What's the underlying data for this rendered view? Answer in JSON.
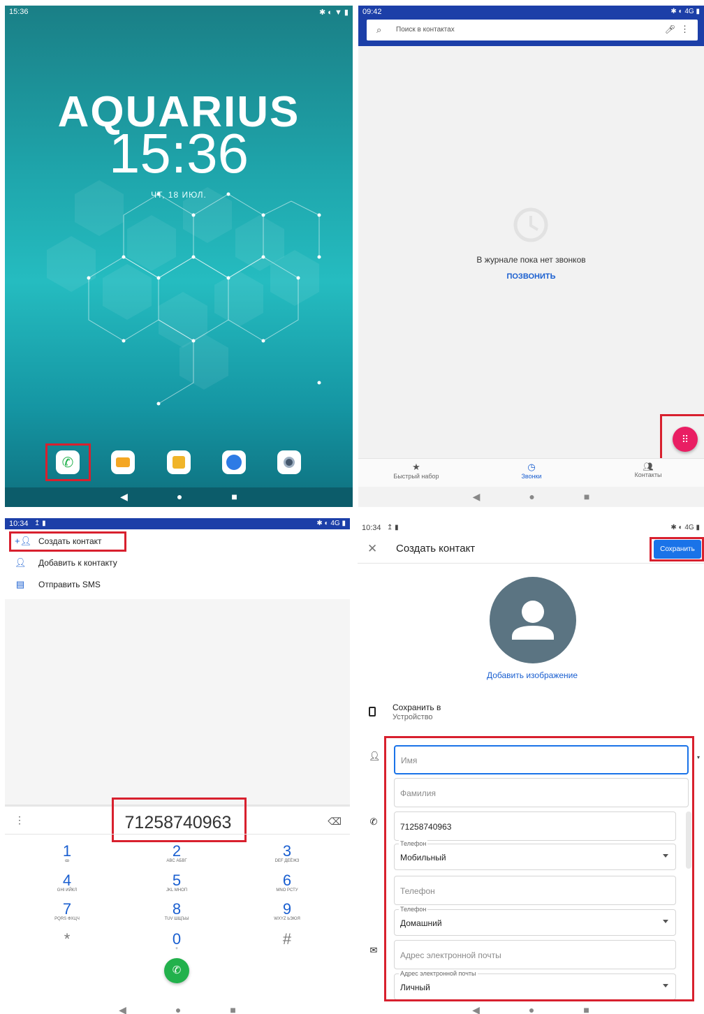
{
  "home": {
    "time_status": "15:36",
    "brand": "AQUARIUS",
    "clock": "15:36",
    "date": "ЧТ, 18 ИЮЛ.",
    "dock": [
      "phone-icon",
      "messages-icon",
      "store-icon",
      "browser-icon",
      "camera-icon"
    ]
  },
  "calls": {
    "time_status": "09:42",
    "search_placeholder": "Поиск в контактах",
    "empty_message": "В журнале пока нет звонков",
    "call_link": "ПОЗВОНИТЬ",
    "tabs": [
      "Быстрый набор",
      "Звонки",
      "Контакты"
    ],
    "status_right": "4G"
  },
  "dialer": {
    "time_status": "10:34",
    "menu": [
      "Создать контакт",
      "Добавить к контакту",
      "Отправить SMS"
    ],
    "number": "71258740963",
    "keys": [
      {
        "d": "1",
        "s": "ꝏ"
      },
      {
        "d": "2",
        "s": "ABC АБВГ"
      },
      {
        "d": "3",
        "s": "DEF ДЕЁЖЗ"
      },
      {
        "d": "4",
        "s": "GHI ИЙКЛ"
      },
      {
        "d": "5",
        "s": "JKL МНОП"
      },
      {
        "d": "6",
        "s": "MNO РСТУ"
      },
      {
        "d": "7",
        "s": "PQRS ФХЦЧ"
      },
      {
        "d": "8",
        "s": "TUV ШЩЪЫ"
      },
      {
        "d": "9",
        "s": "WXYZ ЬЭЮЯ"
      },
      {
        "d": "*",
        "s": ""
      },
      {
        "d": "0",
        "s": "+"
      },
      {
        "d": "#",
        "s": ""
      }
    ]
  },
  "contact": {
    "time_status": "10:34",
    "title": "Создать контакт",
    "save": "Сохранить",
    "add_image": "Добавить изображение",
    "save_to_label": "Сохранить в",
    "save_to_value": "Устройство",
    "first_name_placeholder": "Имя",
    "last_name_placeholder": "Фамилия",
    "phone_value": "71258740963",
    "phone_type_caption": "Телефон",
    "phone_type_value": "Мобильный",
    "phone2_placeholder": "Телефон",
    "phone2_type_caption": "Телефон",
    "phone2_type_value": "Домашний",
    "email_placeholder": "Адрес электронной почты",
    "email_type_caption": "Адрес электронной почты",
    "email_type_value": "Личный"
  },
  "colors": {
    "statusbar": "#1c3fa8",
    "accent": "#1a5fd0",
    "highlight": "#d8202e",
    "fab": "#e91e63",
    "call_green": "#22b14c"
  }
}
